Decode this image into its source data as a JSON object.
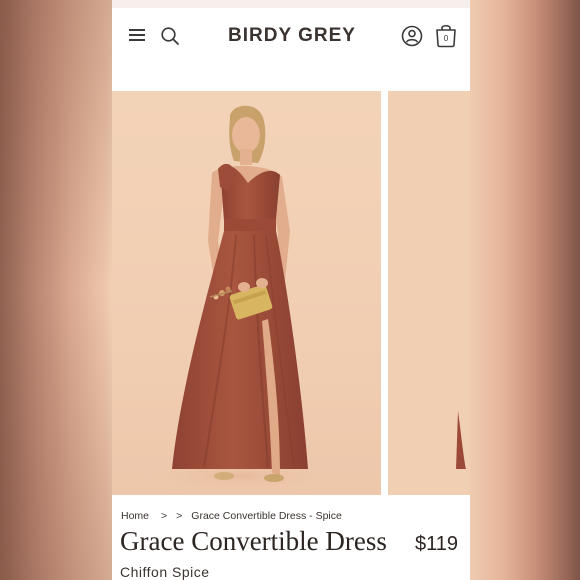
{
  "header": {
    "brand": "BIRDY GREY",
    "icons": [
      "menu-icon",
      "search-icon",
      "account-icon",
      "shopping-bag-icon"
    ],
    "cart_count": "0"
  },
  "breadcrumb": {
    "home": "Home",
    "sep1": ">",
    "sep2": ">",
    "current": "Grace Convertible Dress - Spice"
  },
  "product": {
    "title": "Grace Convertible Dress",
    "price": "$119",
    "variant": "Chiffon Spice"
  },
  "colors": {
    "dress": "#a2503c",
    "backdrop": "#f1ceb2",
    "text": "#2c2522"
  }
}
